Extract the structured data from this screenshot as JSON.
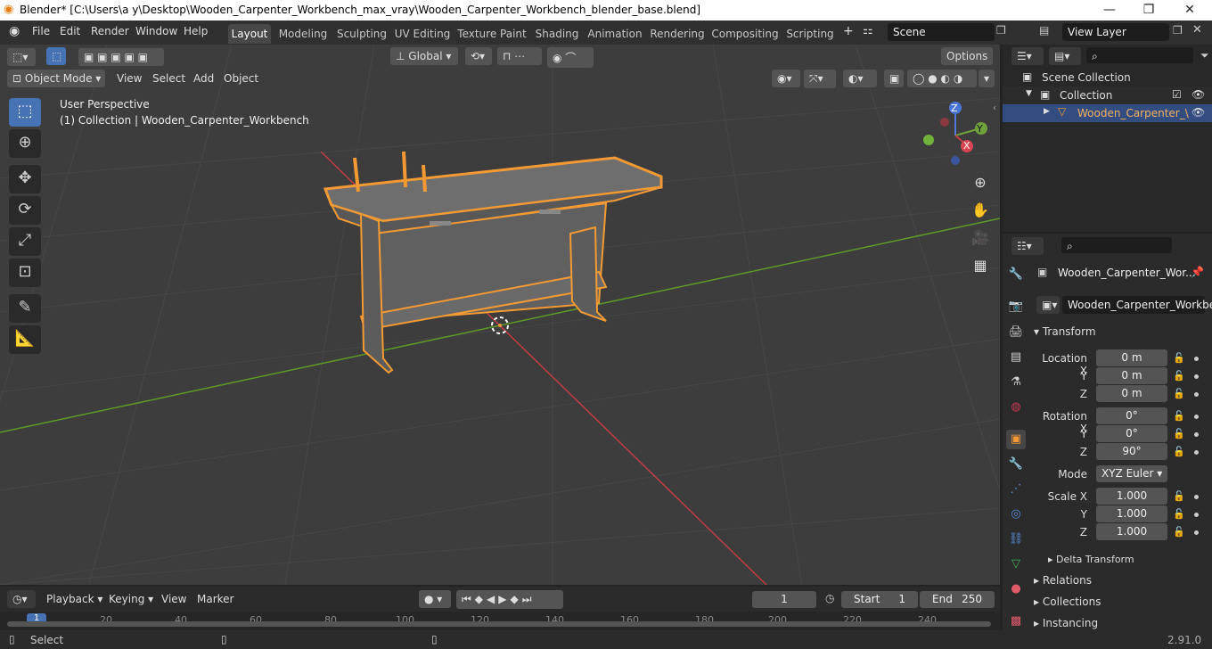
{
  "titlebar": {
    "title": "Blender* [C:\\Users\\a y\\Desktop\\Wooden_Carpenter_Workbench_max_vray\\Wooden_Carpenter_Workbench_blender_base.blend]",
    "minimize": "—",
    "maximize": "❐",
    "close": "✕"
  },
  "menu": [
    "File",
    "Edit",
    "Render",
    "Window",
    "Help"
  ],
  "workspaces": [
    "Layout",
    "Modeling",
    "Sculpting",
    "UV Editing",
    "Texture Paint",
    "Shading",
    "Animation",
    "Rendering",
    "Compositing",
    "Scripting"
  ],
  "add_workspace": "+",
  "scene": {
    "label": "Scene",
    "view_layer": "View Layer"
  },
  "viewport_header": {
    "transform_orientation": "Global",
    "options": "Options",
    "mode": "Object Mode",
    "menus": [
      "View",
      "Select",
      "Add",
      "Object"
    ]
  },
  "overlay_text": {
    "perspective": "User Perspective",
    "collection": "(1) Collection | Wooden_Carpenter_Workbench"
  },
  "gizmo": {
    "x": "X",
    "y": "Y",
    "z": "Z"
  },
  "outliner": {
    "scene_collection": "Scene Collection",
    "collection": "Collection",
    "object": "Wooden_Carpenter_\\"
  },
  "properties": {
    "object_name": "Wooden_Carpenter_Wor...",
    "data_name": "Wooden_Carpenter_Workbe...",
    "transform": "Transform",
    "location_label": "Location X",
    "y_label": "Y",
    "z_label": "Z",
    "loc_x": "0 m",
    "loc_y": "0 m",
    "loc_z": "0 m",
    "rotation_label": "Rotation X",
    "rot_x": "0°",
    "rot_y": "0°",
    "rot_z": "90°",
    "mode_label": "Mode",
    "mode_value": "XYZ Euler",
    "scale_label": "Scale X",
    "scale_x": "1.000",
    "scale_y": "1.000",
    "scale_z": "1.000",
    "delta": "Delta Transform",
    "relations": "Relations",
    "collections": "Collections",
    "instancing": "Instancing"
  },
  "timeline": {
    "menus": [
      "Playback",
      "Keying",
      "View",
      "Marker"
    ],
    "current": "1",
    "start_label": "Start",
    "start": "1",
    "end_label": "End",
    "end": "250",
    "ticks": [
      "1",
      "20",
      "40",
      "60",
      "80",
      "100",
      "120",
      "140",
      "160",
      "180",
      "200",
      "220",
      "240"
    ]
  },
  "status": {
    "left": "Select",
    "version": "2.91.0"
  },
  "colors": {
    "accent": "#4772b3",
    "selection": "#f39a34",
    "x_axis": "#c13d44",
    "y_axis": "#5e9a2a"
  }
}
